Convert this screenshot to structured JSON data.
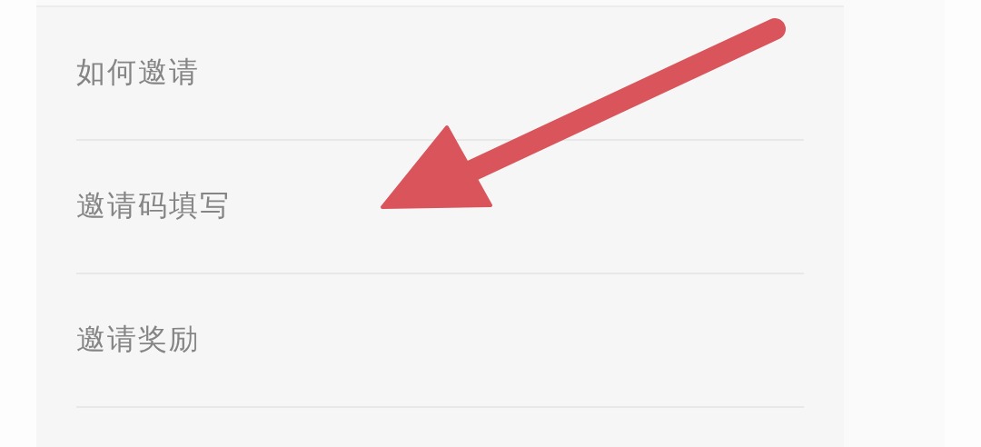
{
  "menu": {
    "items": [
      {
        "label": "如何邀请"
      },
      {
        "label": "邀请码填写"
      },
      {
        "label": "邀请奖励"
      }
    ]
  }
}
